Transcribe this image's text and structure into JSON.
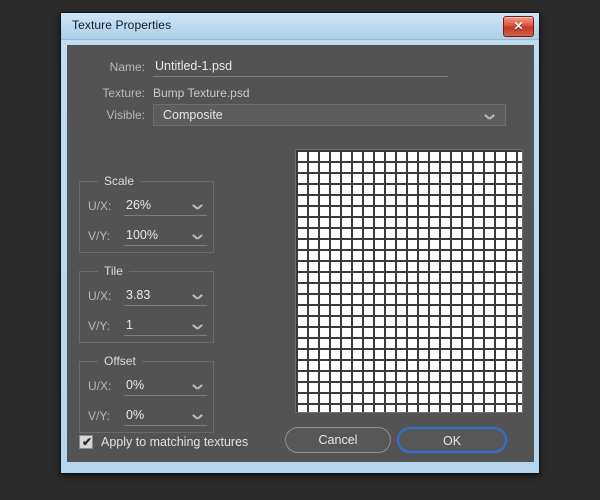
{
  "window": {
    "title": "Texture Properties",
    "close_icon": "close-x-icon",
    "close_glyph": "✕"
  },
  "form": {
    "name": {
      "label": "Name:",
      "value": "Untitled-1.psd",
      "placeholder": "Untitled-1.psd"
    },
    "texture": {
      "label": "Texture:",
      "value": "Bump Texture.psd"
    },
    "visible": {
      "label": "Visible:",
      "value": "Composite",
      "options": [
        "Composite"
      ],
      "chevron_icon": "chevron-down-icon"
    }
  },
  "groups": [
    {
      "legend": "Scale",
      "rows": [
        {
          "label": "U/X:",
          "value": "26%"
        },
        {
          "label": "V/Y:",
          "value": "100%"
        }
      ]
    },
    {
      "legend": "Tile",
      "rows": [
        {
          "label": "U/X:",
          "value": "3.83"
        },
        {
          "label": "V/Y:",
          "value": "1"
        }
      ]
    },
    {
      "legend": "Offset",
      "rows": [
        {
          "label": "U/X:",
          "value": "0%"
        },
        {
          "label": "V/Y:",
          "value": "0%"
        }
      ]
    }
  ],
  "preview": {
    "name": "texture-preview",
    "description": "checkerboard grid texture preview",
    "columns": 20,
    "rows": 23,
    "cell_color": "#fdfdfd",
    "line_color": "#3b3b3b"
  },
  "footer": {
    "apply_label": "Apply to matching textures",
    "apply_checked": true,
    "check_glyph": "✔",
    "cancel_label": "Cancel",
    "ok_label": "OK"
  },
  "colors": {
    "dialog_body": "#535353",
    "titlebar": "#bcd8ef",
    "desktop": "#2b2b2b",
    "focus_ring": "#2f6fdc",
    "close_button": "#c23a23"
  }
}
